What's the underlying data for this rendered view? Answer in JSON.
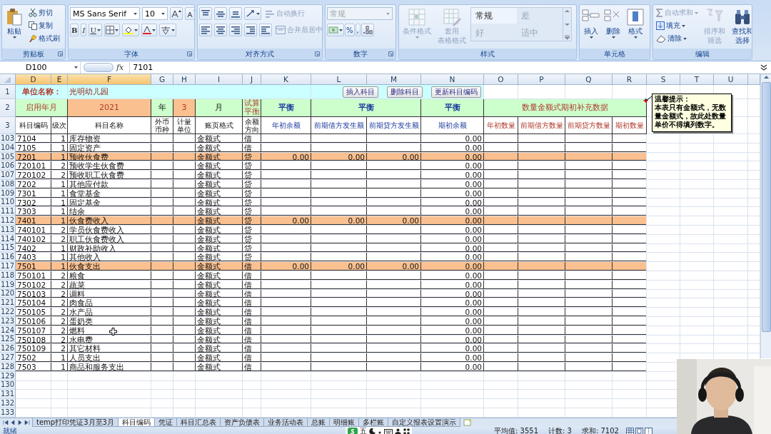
{
  "ribbon": {
    "clipboard": {
      "label": "剪贴板",
      "paste": "粘贴",
      "cut": "剪切",
      "copy": "复制",
      "format_painter": "格式刷"
    },
    "font": {
      "label": "字体",
      "font_name": "MS Sans Serif",
      "font_size": "10",
      "bold": "B",
      "italic": "I",
      "underline": "U"
    },
    "alignment": {
      "label": "对齐方式",
      "wrap": {
        "label": "自动换行",
        "disabled": true
      },
      "merge": {
        "label": "合并后居中",
        "disabled": true
      }
    },
    "number": {
      "label": "数字",
      "format": {
        "value": "常规",
        "disabled": true
      },
      "percent": "%",
      "comma": ","
    },
    "styles": {
      "label": "样式",
      "conditional": {
        "label": "条件格式",
        "disabled": true
      },
      "table_format": {
        "lines": [
          "套用",
          "表格格式"
        ],
        "disabled": true
      },
      "cell_styles": [
        "常规",
        "差",
        "好",
        "适中"
      ]
    },
    "cells": {
      "label": "单元格",
      "buttons": [
        "插入",
        "删除",
        "格式"
      ]
    },
    "editing": {
      "label": "编辑",
      "autosum": {
        "label": "自动求和",
        "disabled": true
      },
      "fill": {
        "label": "填充",
        "disabled": false
      },
      "clear": {
        "label": "清除",
        "disabled": false
      },
      "sort": {
        "lines": [
          "排序和",
          "筛选"
        ],
        "disabled": true
      },
      "find": {
        "lines": [
          "查找和",
          "选择"
        ],
        "disabled": false
      }
    }
  },
  "formula_bar": {
    "name_box": "D100",
    "function_label": "fx",
    "formula": "7101"
  },
  "sheet": {
    "columns": [
      {
        "label": "D",
        "selected": true
      },
      {
        "label": "E",
        "selected": true
      },
      {
        "label": "F",
        "selected": true
      },
      {
        "label": "G",
        "selected": false
      },
      {
        "label": "H",
        "selected": false
      },
      {
        "label": "I",
        "selected": false
      },
      {
        "label": "J",
        "selected": false
      },
      {
        "label": "K",
        "selected": false
      },
      {
        "label": "L",
        "selected": false
      },
      {
        "label": "M",
        "selected": false
      },
      {
        "label": "N",
        "selected": false
      },
      {
        "label": "O",
        "selected": false
      },
      {
        "label": "P",
        "selected": false
      },
      {
        "label": "Q",
        "selected": false
      },
      {
        "label": "R",
        "selected": false
      },
      {
        "label": "S",
        "selected": false
      },
      {
        "label": "T",
        "selected": false
      },
      {
        "label": "U",
        "selected": false
      }
    ],
    "title_row": {
      "row": "1",
      "label": "单位名称：",
      "value": "光明幼儿园",
      "buttons": [
        "插入科目",
        "删除科目",
        "更新科目编码"
      ]
    },
    "setting_row": {
      "row": "2",
      "cells": [
        {
          "text": "启用年月",
          "kind": "caption"
        },
        {
          "text": "2021",
          "kind": "input"
        },
        {
          "text": "年",
          "kind": "unit"
        },
        {
          "text": "3",
          "kind": "input"
        },
        {
          "text": "月",
          "kind": "unit"
        },
        {
          "text": "试算平衡",
          "kind": "caption"
        },
        {
          "text": "平衡",
          "kind": "status"
        },
        {
          "text": "平衡",
          "kind": "status"
        },
        {
          "text": "平衡",
          "kind": "status"
        },
        {
          "text": "数量金额式期初补充数据",
          "kind": "caption"
        }
      ]
    },
    "header_row": {
      "row": "3",
      "headers": [
        "科目编码",
        "级次",
        "科目名称",
        "外币币种",
        "计量单位",
        "账页格式",
        "余额方向",
        "年初余额",
        "前期借方发生额",
        "前期贷方发生额",
        "期初余额",
        "年初数量",
        "前期借方数量",
        "前期贷方数量",
        "期初数量"
      ]
    },
    "note": {
      "title": "温馨提示：",
      "text": "本表只有金额式，无数量金额式，故此处数量单价不得填列数字。"
    },
    "rows": [
      {
        "row": "103",
        "code": "7104",
        "level": "1",
        "name": "库存物资",
        "format": "金额式",
        "direction": "借",
        "highlighted": false,
        "opening": "0.00"
      },
      {
        "row": "104",
        "code": "7105",
        "level": "1",
        "name": "固定资产",
        "format": "金额式",
        "direction": "借",
        "highlighted": false,
        "opening": "0.00"
      },
      {
        "row": "105",
        "code": "7201",
        "level": "1",
        "name": "预收伙食费",
        "format": "金额式",
        "direction": "贷",
        "highlighted": true,
        "year_opening": "0.00",
        "prior_debit": "0.00",
        "prior_credit": "0.00",
        "opening": "0.00"
      },
      {
        "row": "106",
        "code": "720101",
        "level": "2",
        "name": "预收学生伙食费",
        "format": "金额式",
        "direction": "贷",
        "highlighted": false,
        "opening": "0.00"
      },
      {
        "row": "107",
        "code": "720102",
        "level": "2",
        "name": "预收职工伙食费",
        "format": "金额式",
        "direction": "贷",
        "highlighted": false,
        "opening": "0.00"
      },
      {
        "row": "108",
        "code": "7202",
        "level": "1",
        "name": "其他应付款",
        "format": "金额式",
        "direction": "贷",
        "highlighted": false,
        "opening": "0.00"
      },
      {
        "row": "109",
        "code": "7301",
        "level": "1",
        "name": "食堂基金",
        "format": "金额式",
        "direction": "贷",
        "highlighted": false,
        "opening": "0.00"
      },
      {
        "row": "110",
        "code": "7302",
        "level": "1",
        "name": "固定基金",
        "format": "金额式",
        "direction": "贷",
        "highlighted": false,
        "opening": "0.00"
      },
      {
        "row": "111",
        "code": "7303",
        "level": "1",
        "name": "结余",
        "format": "金额式",
        "direction": "贷",
        "highlighted": false,
        "opening": "0.00"
      },
      {
        "row": "112",
        "code": "7401",
        "level": "1",
        "name": "伙食费收入",
        "format": "金额式",
        "direction": "贷",
        "highlighted": true,
        "year_opening": "0.00",
        "prior_debit": "0.00",
        "prior_credit": "0.00",
        "opening": "0.00"
      },
      {
        "row": "113",
        "code": "740101",
        "level": "2",
        "name": "学员伙食费收入",
        "format": "金额式",
        "direction": "贷",
        "highlighted": false,
        "opening": "0.00"
      },
      {
        "row": "114",
        "code": "740102",
        "level": "2",
        "name": "职工伙食费收入",
        "format": "金额式",
        "direction": "贷",
        "highlighted": false,
        "opening": "0.00"
      },
      {
        "row": "115",
        "code": "7402",
        "level": "1",
        "name": "财政补助收入",
        "format": "金额式",
        "direction": "贷",
        "highlighted": false,
        "opening": "0.00"
      },
      {
        "row": "116",
        "code": "7403",
        "level": "1",
        "name": "其他收入",
        "format": "金额式",
        "direction": "贷",
        "highlighted": false,
        "opening": "0.00"
      },
      {
        "row": "117",
        "code": "7501",
        "level": "1",
        "name": "伙食支出",
        "format": "金额式",
        "direction": "借",
        "highlighted": true,
        "year_opening": "0.00",
        "prior_debit": "0.00",
        "prior_credit": "0.00",
        "opening": "0.00"
      },
      {
        "row": "118",
        "code": "750101",
        "level": "2",
        "name": "粮食",
        "format": "金额式",
        "direction": "借",
        "highlighted": false,
        "opening": "0.00"
      },
      {
        "row": "119",
        "code": "750102",
        "level": "2",
        "name": "蔬菜",
        "format": "金额式",
        "direction": "借",
        "highlighted": false,
        "opening": "0.00"
      },
      {
        "row": "120",
        "code": "750103",
        "level": "2",
        "name": "调料",
        "format": "金额式",
        "direction": "借",
        "highlighted": false,
        "opening": "0.00"
      },
      {
        "row": "121",
        "code": "750104",
        "level": "2",
        "name": "肉食品",
        "format": "金额式",
        "direction": "借",
        "highlighted": false,
        "opening": "0.00"
      },
      {
        "row": "122",
        "code": "750105",
        "level": "2",
        "name": "水产品",
        "format": "金额式",
        "direction": "借",
        "highlighted": false,
        "opening": "0.00"
      },
      {
        "row": "123",
        "code": "750106",
        "level": "2",
        "name": "蛋奶类",
        "format": "金额式",
        "direction": "借",
        "highlighted": false,
        "opening": "0.00"
      },
      {
        "row": "124",
        "code": "750107",
        "level": "2",
        "name": "燃料",
        "format": "金额式",
        "direction": "借",
        "highlighted": false,
        "opening": "0.00"
      },
      {
        "row": "125",
        "code": "750108",
        "level": "2",
        "name": "水电费",
        "format": "金额式",
        "direction": "借",
        "highlighted": false,
        "opening": "0.00"
      },
      {
        "row": "126",
        "code": "750109",
        "level": "2",
        "name": "其它材料",
        "format": "金额式",
        "direction": "借",
        "highlighted": false,
        "opening": "0.00"
      },
      {
        "row": "127",
        "code": "7502",
        "level": "1",
        "name": "人员支出",
        "format": "金额式",
        "direction": "借",
        "highlighted": false,
        "opening": "0.00"
      },
      {
        "row": "128",
        "code": "7503",
        "level": "1",
        "name": "商品和服务支出",
        "format": "金额式",
        "direction": "借",
        "highlighted": false,
        "opening": "0.00"
      }
    ],
    "empty_rows": [
      "129",
      "130",
      "131",
      "132",
      "133"
    ]
  },
  "sheet_tabs": [
    {
      "label": "temp打印凭证3月至3月",
      "selected": false
    },
    {
      "label": "科目编码",
      "selected": true
    },
    {
      "label": "凭证",
      "selected": false
    },
    {
      "label": "科目汇总表",
      "selected": false
    },
    {
      "label": "资产负债表",
      "selected": false
    },
    {
      "label": "业务活动表",
      "selected": false
    },
    {
      "label": "总账",
      "selected": false
    },
    {
      "label": "明细账",
      "selected": false
    },
    {
      "label": "多栏账",
      "selected": false
    },
    {
      "label": "自定义报表设置演示",
      "selected": false
    }
  ],
  "status_bar": {
    "status": "就绪",
    "ime_mode": "五",
    "average": "平均值: 3551",
    "count": "计数: 3",
    "sum": "求和: 7102"
  }
}
